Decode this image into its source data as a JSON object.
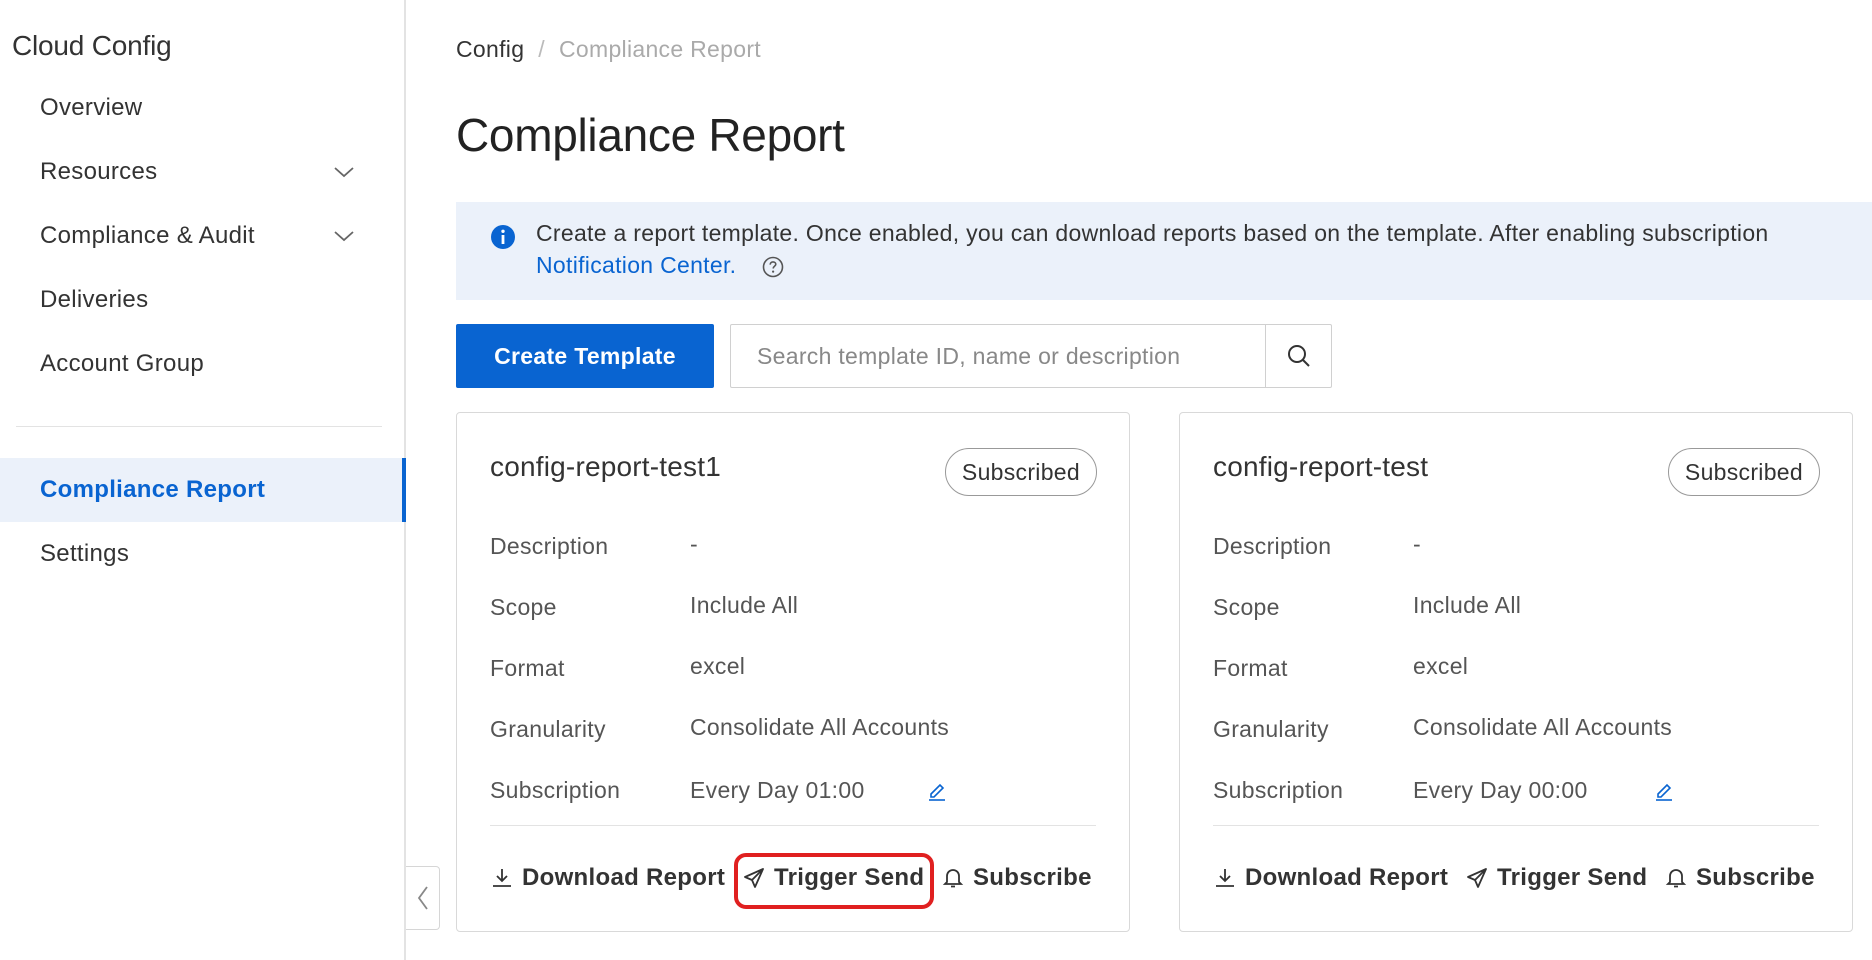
{
  "sidebar": {
    "app_title": "Cloud Config",
    "items": [
      {
        "label": "Overview"
      },
      {
        "label": "Resources"
      },
      {
        "label": "Compliance & Audit"
      },
      {
        "label": "Deliveries"
      },
      {
        "label": "Account Group"
      },
      {
        "label": "Compliance Report"
      },
      {
        "label": "Settings"
      }
    ]
  },
  "breadcrumb": {
    "root": "Config",
    "separator": "/",
    "current": "Compliance Report"
  },
  "page_title": "Compliance Report",
  "info": {
    "text": "Create a report template. Once enabled, you can download reports based on the template. After enabling subscription",
    "link": "Notification Center."
  },
  "toolbar": {
    "create_label": "Create Template",
    "search_placeholder": "Search template ID, name or description"
  },
  "cards": [
    {
      "title": "config-report-test1",
      "badge": "Subscribed",
      "rows": [
        {
          "label": "Description",
          "value": "-"
        },
        {
          "label": "Scope",
          "value": "Include All"
        },
        {
          "label": "Format",
          "value": "excel"
        },
        {
          "label": "Granularity",
          "value": "Consolidate All Accounts"
        },
        {
          "label": "Subscription",
          "value": "Every Day 01:00"
        }
      ],
      "actions": {
        "download": "Download Report",
        "trigger": "Trigger Send",
        "subscribe": "Subscribe"
      }
    },
    {
      "title": "config-report-test",
      "badge": "Subscribed",
      "rows": [
        {
          "label": "Description",
          "value": "-"
        },
        {
          "label": "Scope",
          "value": "Include All"
        },
        {
          "label": "Format",
          "value": "excel"
        },
        {
          "label": "Granularity",
          "value": "Consolidate All Accounts"
        },
        {
          "label": "Subscription",
          "value": "Every Day 00:00"
        }
      ],
      "actions": {
        "download": "Download Report",
        "trigger": "Trigger Send",
        "subscribe": "Subscribe"
      }
    }
  ],
  "colors": {
    "accent": "#0964d1",
    "highlight": "#e02020",
    "banner_bg": "#ebf1fa"
  },
  "icons": [
    "chevron-down-icon",
    "chevron-left-icon",
    "info-icon",
    "help-icon",
    "search-icon",
    "edit-icon",
    "download-icon",
    "send-icon",
    "bell-icon"
  ]
}
